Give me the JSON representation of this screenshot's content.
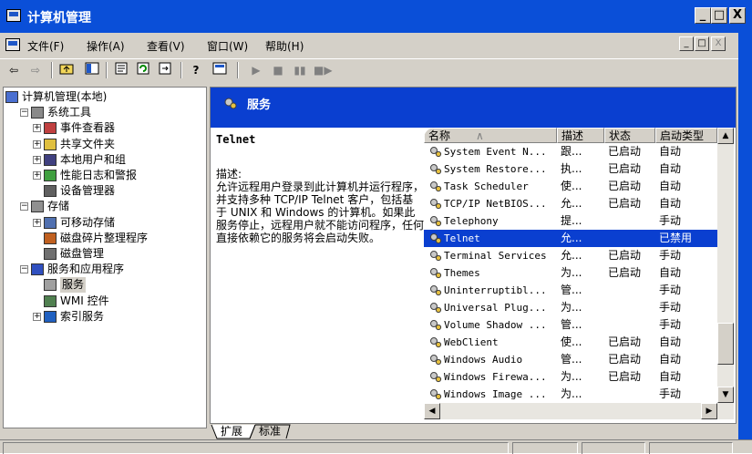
{
  "window": {
    "title": "计算机管理"
  },
  "menu": [
    "文件(F)",
    "操作(A)",
    "查看(V)",
    "窗口(W)",
    "帮助(H)"
  ],
  "title_controls": [
    "_",
    "□",
    "X"
  ],
  "mdi_controls": [
    "_",
    "□",
    "X"
  ],
  "toolbar_icons": [
    "back-arrow-icon",
    "forward-arrow-icon",
    "up-folder-icon",
    "show-tree-icon",
    "properties-icon",
    "refresh-icon",
    "export-icon",
    "help-icon",
    "console-icon",
    "play-icon",
    "stop-icon",
    "pause-icon",
    "restart-icon"
  ],
  "tree": [
    {
      "label": "计算机管理(本地)",
      "level": 0,
      "expander": "",
      "icon": "computer-icon"
    },
    {
      "label": "系统工具",
      "level": 1,
      "expander": "-",
      "icon": "tools-icon"
    },
    {
      "label": "事件查看器",
      "level": 2,
      "expander": "+",
      "icon": "event-viewer-icon"
    },
    {
      "label": "共享文件夹",
      "level": 2,
      "expander": "+",
      "icon": "shared-folder-icon"
    },
    {
      "label": "本地用户和组",
      "level": 2,
      "expander": "+",
      "icon": "users-icon"
    },
    {
      "label": "性能日志和警报",
      "level": 2,
      "expander": "+",
      "icon": "performance-icon"
    },
    {
      "label": "设备管理器",
      "level": 2,
      "expander": "",
      "icon": "device-manager-icon"
    },
    {
      "label": "存储",
      "level": 1,
      "expander": "-",
      "icon": "storage-icon"
    },
    {
      "label": "可移动存储",
      "level": 2,
      "expander": "+",
      "icon": "removable-storage-icon"
    },
    {
      "label": "磁盘碎片整理程序",
      "level": 2,
      "expander": "",
      "icon": "defrag-icon"
    },
    {
      "label": "磁盘管理",
      "level": 2,
      "expander": "",
      "icon": "disk-management-icon"
    },
    {
      "label": "服务和应用程序",
      "level": 1,
      "expander": "-",
      "icon": "services-apps-icon"
    },
    {
      "label": "服务",
      "level": 2,
      "expander": "",
      "icon": "services-gear-icon"
    },
    {
      "label": "WMI 控件",
      "level": 2,
      "expander": "",
      "icon": "wmi-icon"
    },
    {
      "label": "索引服务",
      "level": 2,
      "expander": "+",
      "icon": "indexing-icon"
    }
  ],
  "services_header": "服务",
  "description": {
    "service_name": "Telnet",
    "label": "描述:",
    "text": "允许远程用户登录到此计算机并运行程序，并支持多种 TCP/IP Telnet 客户，包括基于 UNIX 和 Windows 的计算机。如果此服务停止，远程用户就不能访问程序，任何直接依赖它的服务将会启动失败。"
  },
  "columns": [
    "名称",
    "描述",
    "状态",
    "启动类型"
  ],
  "services": [
    {
      "name": "System Event N...",
      "desc": "跟...",
      "status": "已启动",
      "startup": "自动"
    },
    {
      "name": "System Restore...",
      "desc": "执...",
      "status": "已启动",
      "startup": "自动"
    },
    {
      "name": "Task Scheduler",
      "desc": "使...",
      "status": "已启动",
      "startup": "自动"
    },
    {
      "name": "TCP/IP NetBIOS...",
      "desc": "允...",
      "status": "已启动",
      "startup": "自动"
    },
    {
      "name": "Telephony",
      "desc": "提...",
      "status": "",
      "startup": "手动"
    },
    {
      "name": "Telnet",
      "desc": "允...",
      "status": "",
      "startup": "已禁用",
      "selected": true
    },
    {
      "name": "Terminal Services",
      "desc": "允...",
      "status": "已启动",
      "startup": "手动"
    },
    {
      "name": "Themes",
      "desc": "为...",
      "status": "已启动",
      "startup": "自动"
    },
    {
      "name": "Uninterruptibl...",
      "desc": "管...",
      "status": "",
      "startup": "手动"
    },
    {
      "name": "Universal Plug...",
      "desc": "为...",
      "status": "",
      "startup": "手动"
    },
    {
      "name": "Volume Shadow ...",
      "desc": "管...",
      "status": "",
      "startup": "手动"
    },
    {
      "name": "WebClient",
      "desc": "使...",
      "status": "已启动",
      "startup": "自动"
    },
    {
      "name": "Windows Audio",
      "desc": "管...",
      "status": "已启动",
      "startup": "自动"
    },
    {
      "name": "Windows Firewa...",
      "desc": "为...",
      "status": "已启动",
      "startup": "自动"
    },
    {
      "name": "Windows Image ...",
      "desc": "为...",
      "status": "",
      "startup": "手动"
    }
  ],
  "tabs": [
    "扩展",
    "标准"
  ],
  "colors": {
    "title_blue": "#0a4fd8",
    "header_blue": "#0a3fd0",
    "face": "#d4d0c8",
    "selection": "#0a3fd0"
  }
}
